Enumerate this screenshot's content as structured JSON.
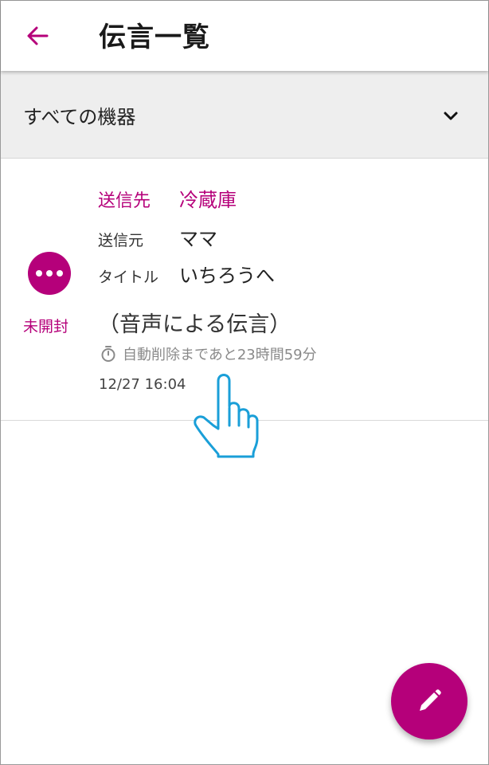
{
  "header": {
    "title": "伝言一覧",
    "back_icon": "arrow-left-icon"
  },
  "filter": {
    "selected": "すべての機器",
    "icon": "chevron-down-icon"
  },
  "messages": [
    {
      "status": "未開封",
      "status_icon": "more-dots-icon",
      "to_label": "送信先",
      "to_value": "冷蔵庫",
      "from_label": "送信元",
      "from_value": "ママ",
      "title_label": "タイトル",
      "title_value": "いちろうへ",
      "content": "（音声による伝言）",
      "auto_delete": "自動削除まであと23時間59分",
      "datetime": "12/27 16:04"
    }
  ],
  "fab": {
    "icon": "pencil-icon"
  },
  "colors": {
    "accent": "#b5007a",
    "filter_bg": "#eeeeee",
    "hand_cursor": "#1a9fd8"
  }
}
